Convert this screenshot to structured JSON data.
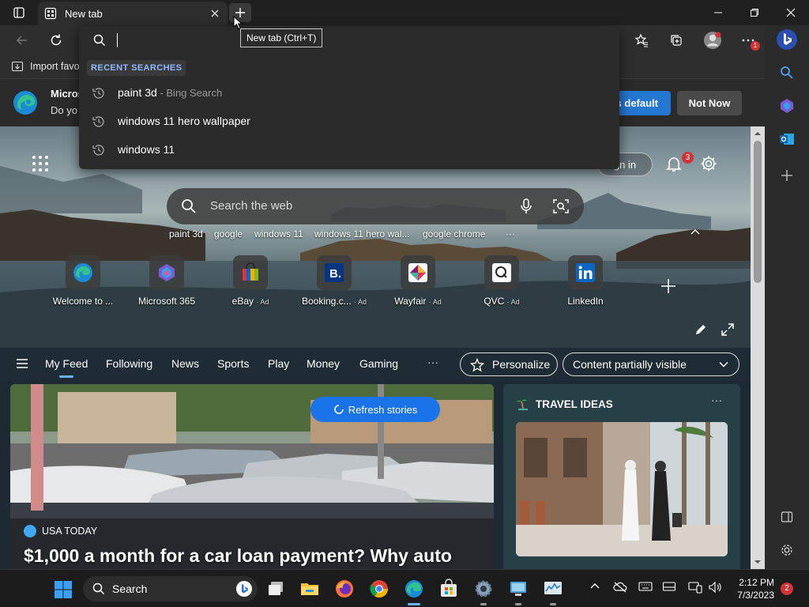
{
  "browser": {
    "tab_title": "New tab",
    "tooltip": "New tab (Ctrl+T)",
    "menu_badge": "1"
  },
  "favorites": {
    "import_label": "Import favo"
  },
  "omnibox": {
    "section_label": "RECENT SEARCHES",
    "items": [
      {
        "text": "paint 3d",
        "suffix": " - Bing Search"
      },
      {
        "text": "windows 11 hero wallpaper",
        "suffix": ""
      },
      {
        "text": "windows 11",
        "suffix": ""
      }
    ]
  },
  "infobar": {
    "title": "Micros",
    "text": "Do yo",
    "set_default_label": "s default",
    "not_now_label": "Not Now"
  },
  "newtab": {
    "sign_in_label": "gn in",
    "notification_count": "3",
    "search_placeholder": "Search the web",
    "trending": [
      "paint 3d",
      "google",
      "windows 11",
      "windows 11 hero wal...",
      "google chrome"
    ],
    "quick_links": [
      {
        "label": "Welcome to ...",
        "ad": "",
        "icon": "edge-icon"
      },
      {
        "label": "Microsoft 365",
        "ad": "",
        "icon": "m365-icon"
      },
      {
        "label": "eBay",
        "ad": "· Ad",
        "icon": "ebay-icon"
      },
      {
        "label": "Booking.c...",
        "ad": "· Ad",
        "icon": "booking-icon"
      },
      {
        "label": "Wayfair",
        "ad": "· Ad",
        "icon": "wayfair-icon"
      },
      {
        "label": "QVC",
        "ad": "· Ad",
        "icon": "qvc-icon"
      },
      {
        "label": "LinkedIn",
        "ad": "",
        "icon": "linkedin-icon"
      }
    ]
  },
  "feed": {
    "tabs": [
      "My Feed",
      "Following",
      "News",
      "Sports",
      "Play",
      "Money",
      "Gaming"
    ],
    "more": "···",
    "personalize_label": "Personalize",
    "content_dropdown": "Content partially visible",
    "refresh_label": "Refresh stories",
    "story": {
      "source": "USA TODAY",
      "headline": "$1,000 a month for a car loan payment? Why auto"
    },
    "travel": {
      "title": "TRAVEL IDEAS",
      "more": "···"
    }
  },
  "taskbar": {
    "search_label": "Search",
    "time": "2:12 PM",
    "date": "7/3/2023",
    "notification_count": "2"
  },
  "colors": {
    "accent": "#2477d1",
    "badge": "#d13438",
    "chrome_bg": "#202020",
    "toolbar_bg": "#2e2e2e"
  }
}
